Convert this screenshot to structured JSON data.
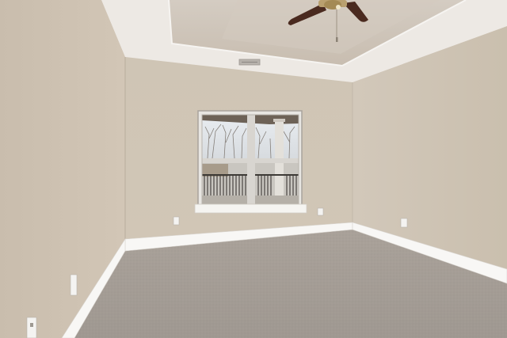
{
  "scene": {
    "subject": "empty-room",
    "wall_color": "#cdc3b4",
    "carpet_color": "#a49d96",
    "ceiling_color": "#ece8e3",
    "trim_color": "#fbfaf8"
  }
}
